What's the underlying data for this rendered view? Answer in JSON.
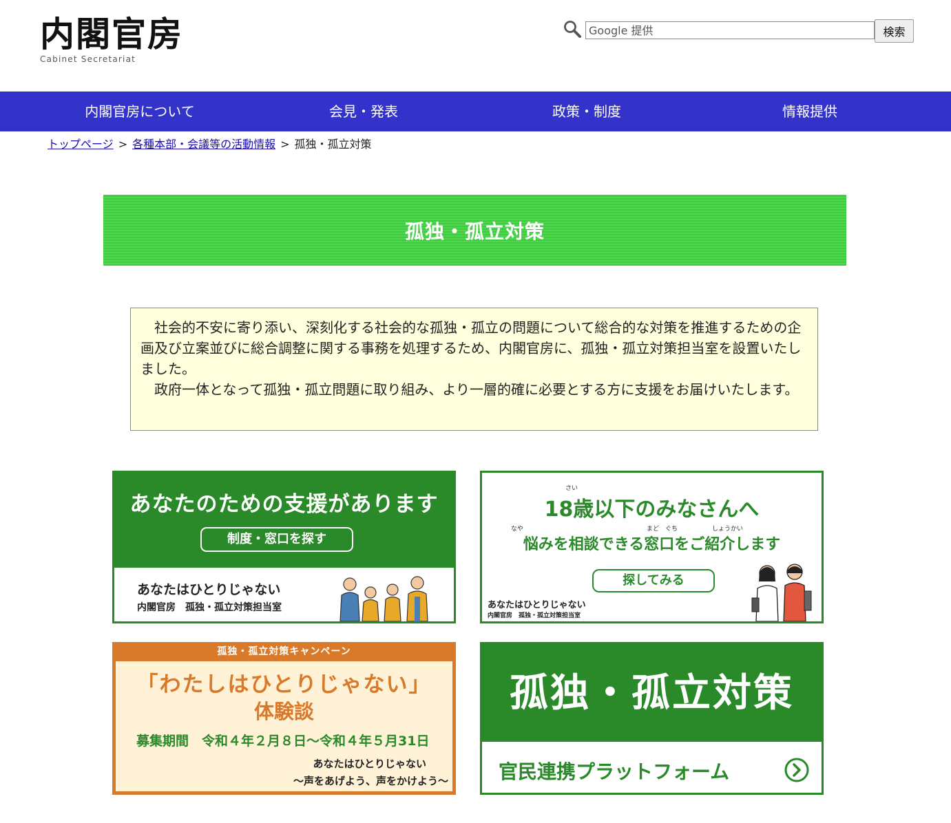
{
  "header": {
    "logo_title": "内閣官房",
    "logo_subtitle": "Cabinet Secretariat",
    "search_placeholder": "Google 提供",
    "search_button": "検索"
  },
  "nav": {
    "items": [
      "内閣官房について",
      "会見・発表",
      "政策・制度",
      "情報提供"
    ]
  },
  "breadcrumb": {
    "links": [
      "トップページ",
      "各種本部・会議等の活動情報"
    ],
    "separator": ">",
    "current": "孤独・孤立対策"
  },
  "page_title": "孤独・孤立対策",
  "intro": {
    "paragraph1": "社会的不安に寄り添い、深刻化する社会的な孤独・孤立の問題について総合的な対策を推進するための企画及び立案並びに総合調整に関する事務を処理するため、内閣官房に、孤独・孤立対策担当室を設置いたしました。",
    "paragraph2": "政府一体となって孤独・孤立問題に取り組み、より一層的確に必要とする方に支援をお届けいたします。"
  },
  "banners": {
    "support": {
      "title": "あなたのための支援があります",
      "button": "制度・窓口を探す",
      "tagline": "あなたはひとりじゃない",
      "org": "内閣官房　孤独・孤立対策担当室"
    },
    "youth": {
      "title": "18歳以下のみなさんへ",
      "title_ruby": "さい",
      "subtitle": "悩みを相談できる窓口をご紹介します",
      "subtitle_ruby": [
        "なや",
        "まど　ぐち",
        "しょうかい"
      ],
      "button": "探してみる",
      "tagline": "あなたはひとりじゃない",
      "org": "内閣官房　孤独・孤立対策担当室"
    },
    "campaign": {
      "header": "孤独・孤立対策キャンペーン",
      "title": "「わたしはひとりじゃない」",
      "title2": "体験談",
      "period": "募集期間　令和４年２月８日～令和４年５月31日",
      "tagline": "あなたはひとりじゃない",
      "tagline2": "～声をあげよう、声をかけよう～"
    },
    "platform": {
      "title": "孤独・孤立対策",
      "subtitle": "官民連携プラットフォーム"
    }
  },
  "colors": {
    "nav_bg": "#3333cc",
    "title_green": "#44cc44",
    "banner_green": "#2a8a2a",
    "campaign_orange": "#d97a2a",
    "intro_bg": "#ffffdd"
  }
}
